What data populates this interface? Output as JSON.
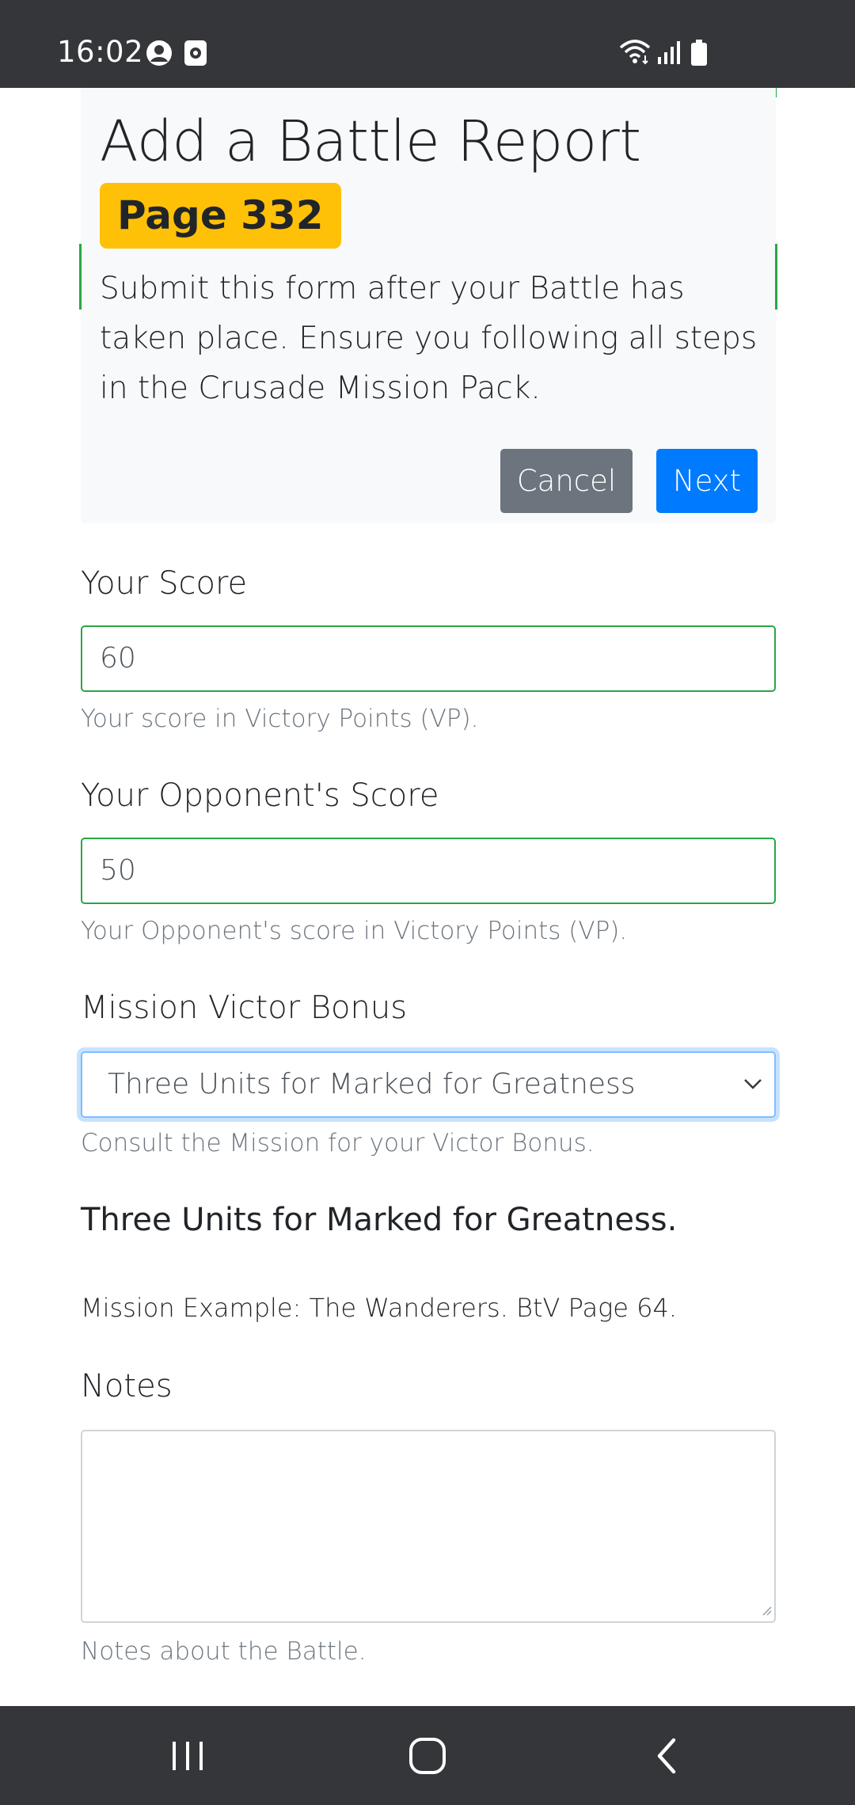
{
  "status_bar": {
    "time": "16:02",
    "icons": [
      "account-circle-icon",
      "screen-record-icon",
      "wifi-icon",
      "signal-icon",
      "battery-icon"
    ]
  },
  "header": {
    "title": "Add a Battle Report",
    "page_badge": "Page 332",
    "lead": "Submit this form after your Battle has taken place. Ensure you following all steps in the Crusade Mission Pack.",
    "cancel_label": "Cancel",
    "next_label": "Next"
  },
  "form": {
    "your_score": {
      "label": "Your Score",
      "value": "60",
      "help": "Your score in Victory Points (VP)."
    },
    "opponent_score": {
      "label": "Your Opponent's Score",
      "value": "50",
      "help": "Your Opponent's score in Victory Points (VP)."
    },
    "victor_bonus": {
      "label": "Mission Victor Bonus",
      "selected": "Three Units for Marked for Greatness",
      "help": "Consult the Mission for your Victor Bonus.",
      "description": "Three Units for Marked for Greatness.",
      "example": "Mission Example: The Wanderers. BtV Page 64."
    },
    "notes": {
      "label": "Notes",
      "value": "",
      "help": "Notes about the Battle."
    }
  },
  "nav_bar": {
    "icons": [
      "recent-apps-icon",
      "home-icon",
      "back-icon"
    ]
  },
  "colors": {
    "status_bar_bg": "#35363a",
    "badge": "#ffc107",
    "cancel_button": "#6c757d",
    "next_button": "#007bff",
    "valid_border": "#28a745",
    "focus_border": "#80bdff"
  }
}
